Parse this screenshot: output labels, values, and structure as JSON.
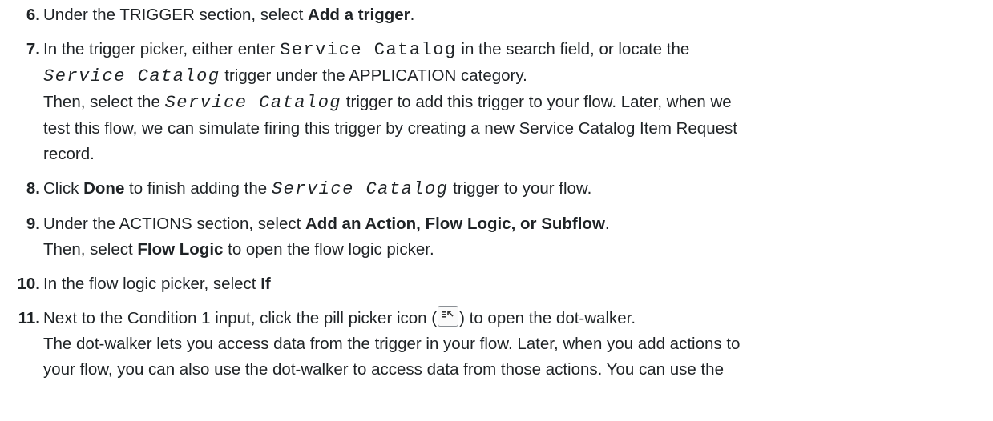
{
  "steps": [
    {
      "number": "6.",
      "lines": [
        {
          "t1": "Under the TRIGGER section, select ",
          "b1": "Add a trigger",
          "t2": "."
        }
      ]
    },
    {
      "number": "7.",
      "l1_a": "In the trigger picker, either enter ",
      "l1_code": "Service Catalog",
      "l1_b": " in the search field, or locate the",
      "l2_code": "Service Catalog",
      "l2_a": " trigger under the APPLICATION category.",
      "l3_a": "Then, select the ",
      "l3_code": "Service Catalog",
      "l3_b": " trigger to add this trigger to your flow. Later, when we",
      "l4": "test this flow, we can simulate firing this trigger by creating a new Service Catalog Item Request",
      "l5": "record."
    },
    {
      "number": "8.",
      "a": "Click ",
      "b": "Done",
      "c": " to finish adding the ",
      "code": "Service Catalog",
      "d": " trigger to your flow."
    },
    {
      "number": "9.",
      "l1_a": "Under the ACTIONS section, select ",
      "l1_b": "Add an Action, Flow Logic, or Subflow",
      "l1_c": ".",
      "l2_a": "Then, select ",
      "l2_b": "Flow Logic",
      "l2_c": " to open the flow logic picker."
    },
    {
      "number": "10.",
      "a": "In the flow logic picker, select ",
      "b": "If"
    },
    {
      "number": "11.",
      "l1_a": "Next to the Condition 1 input, click the pill picker icon (",
      "l1_b": ") to open the dot-walker.",
      "l2": "The dot-walker lets you access data from the trigger in your flow. Later, when you add actions to",
      "l3": "your flow, you can also use the dot-walker to access data from those actions. You can use the"
    }
  ],
  "icons": {
    "pill_picker": "pill-picker-icon"
  }
}
